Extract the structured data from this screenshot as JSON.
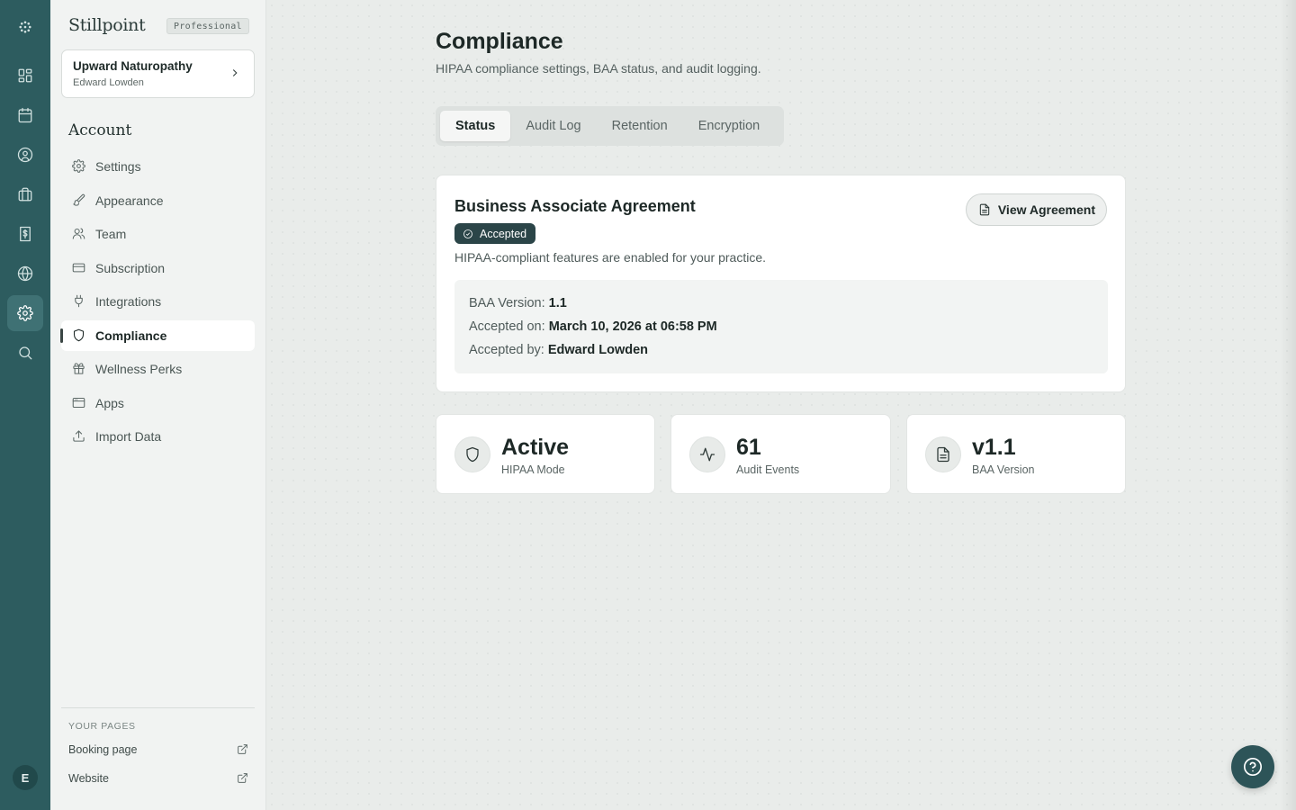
{
  "app": {
    "name": "Stillpoint",
    "plan": "Professional",
    "user_initial": "E"
  },
  "rail": {
    "icons": [
      "logo-icon",
      "dashboard-icon",
      "calendar-icon",
      "clients-icon",
      "services-icon",
      "billing-icon",
      "website-icon",
      "settings-icon",
      "search-icon"
    ],
    "active": "settings-icon"
  },
  "practice": {
    "name": "Upward Naturopathy",
    "owner": "Edward Lowden"
  },
  "sidebar": {
    "section_title": "Account",
    "items": [
      {
        "label": "Settings",
        "icon": "gear-icon"
      },
      {
        "label": "Appearance",
        "icon": "brush-icon"
      },
      {
        "label": "Team",
        "icon": "users-icon"
      },
      {
        "label": "Subscription",
        "icon": "credit-card-icon"
      },
      {
        "label": "Integrations",
        "icon": "plug-icon"
      },
      {
        "label": "Compliance",
        "icon": "shield-icon"
      },
      {
        "label": "Wellness Perks",
        "icon": "gift-icon"
      },
      {
        "label": "Apps",
        "icon": "app-window-icon"
      },
      {
        "label": "Import Data",
        "icon": "upload-icon"
      }
    ],
    "active_item": "Compliance",
    "pages_label": "YOUR PAGES",
    "pages": [
      {
        "label": "Booking page",
        "icon": "external-link-icon"
      },
      {
        "label": "Website",
        "icon": "external-link-icon"
      }
    ]
  },
  "page": {
    "title": "Compliance",
    "subtitle": "HIPAA compliance settings, BAA status, and audit logging."
  },
  "tabs": [
    {
      "label": "Status"
    },
    {
      "label": "Audit Log"
    },
    {
      "label": "Retention"
    },
    {
      "label": "Encryption"
    }
  ],
  "active_tab": "Status",
  "baa": {
    "title": "Business Associate Agreement",
    "status": "Accepted",
    "description": "HIPAA-compliant features are enabled for your practice.",
    "view_button": "View Agreement",
    "version_label": "BAA Version:",
    "version_value": "1.1",
    "accepted_on_label": "Accepted on:",
    "accepted_on_value": "March 10, 2026 at 06:58 PM",
    "accepted_by_label": "Accepted by:",
    "accepted_by_value": "Edward Lowden"
  },
  "stats": [
    {
      "value": "Active",
      "label": "HIPAA Mode",
      "icon": "shield-icon"
    },
    {
      "value": "61",
      "label": "Audit Events",
      "icon": "activity-icon"
    },
    {
      "value": "v1.1",
      "label": "BAA Version",
      "icon": "document-icon"
    }
  ],
  "colors": {
    "rail": "#2d5c5f",
    "accent_dark": "#2b4548",
    "help_button": "#2d5458"
  }
}
